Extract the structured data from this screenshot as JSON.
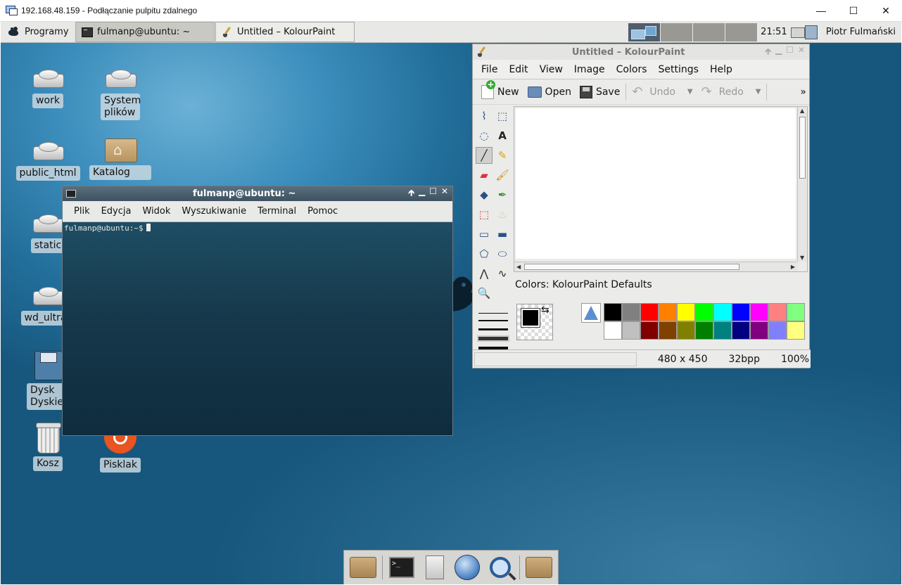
{
  "rdp": {
    "title": "192.168.48.159 - Podłączanie pulpitu zdalnego",
    "minimize": "—",
    "maximize": "☐",
    "close": "✕"
  },
  "panel": {
    "apps_label": "Programy",
    "tasks": [
      {
        "label": "fulmanp@ubuntu: ~",
        "icon": "terminal-icon",
        "active": true
      },
      {
        "label": "Untitled – KolourPaint",
        "icon": "paintbrush-icon",
        "active": false
      }
    ],
    "workspaces": 4,
    "active_workspace": 1,
    "clock": "21:51",
    "user": "Piotr Fulmański"
  },
  "desktop_icons": [
    {
      "label": "work",
      "icon": "drive-icon"
    },
    {
      "label": "System plików",
      "icon": "drive-icon"
    },
    {
      "label": "public_html",
      "icon": "drive-icon"
    },
    {
      "label": "Katalog",
      "icon": "home-folder-icon"
    },
    {
      "label": "static",
      "icon": "drive-icon"
    },
    {
      "label": "wd_ultra_",
      "icon": "drive-icon"
    },
    {
      "label": "Dysk Dyskietk",
      "icon": "floppy-icon"
    },
    {
      "label": "Kosz",
      "icon": "trash-icon"
    },
    {
      "label": "Pisklak",
      "icon": "ubuntu-icon"
    }
  ],
  "terminal": {
    "title": "fulmanp@ubuntu: ~",
    "menu": [
      "Plik",
      "Edycja",
      "Widok",
      "Wyszukiwanie",
      "Terminal",
      "Pomoc"
    ],
    "prompt": "fulmanp@ubuntu:~$"
  },
  "kolourpaint": {
    "title": "Untitled – KolourPaint",
    "menu": [
      "File",
      "Edit",
      "View",
      "Image",
      "Colors",
      "Settings",
      "Help"
    ],
    "toolbar": {
      "new": "New",
      "open": "Open",
      "save": "Save",
      "undo": "Undo",
      "redo": "Redo",
      "more": "»"
    },
    "colors_label": "Colors: KolourPaint Defaults",
    "palette_row1": [
      "#000000",
      "#808080",
      "#ff0000",
      "#ff8000",
      "#ffff00",
      "#00ff00",
      "#00ffff",
      "#0000ff",
      "#ff00ff",
      "#ff8080",
      "#80ff80"
    ],
    "palette_row2": [
      "#ffffff",
      "#c0c0c0",
      "#800000",
      "#804000",
      "#808000",
      "#008000",
      "#008080",
      "#000080",
      "#800080",
      "#8080ff",
      "#ffff80"
    ],
    "foreground_color": "#000000",
    "status": {
      "size": "480 x 450",
      "depth": "32bpp",
      "zoom": "100%"
    }
  },
  "dock": [
    "folder-icon",
    "terminal-icon",
    "file-cabinet-icon",
    "web-browser-icon",
    "search-icon",
    "folder-icon"
  ]
}
